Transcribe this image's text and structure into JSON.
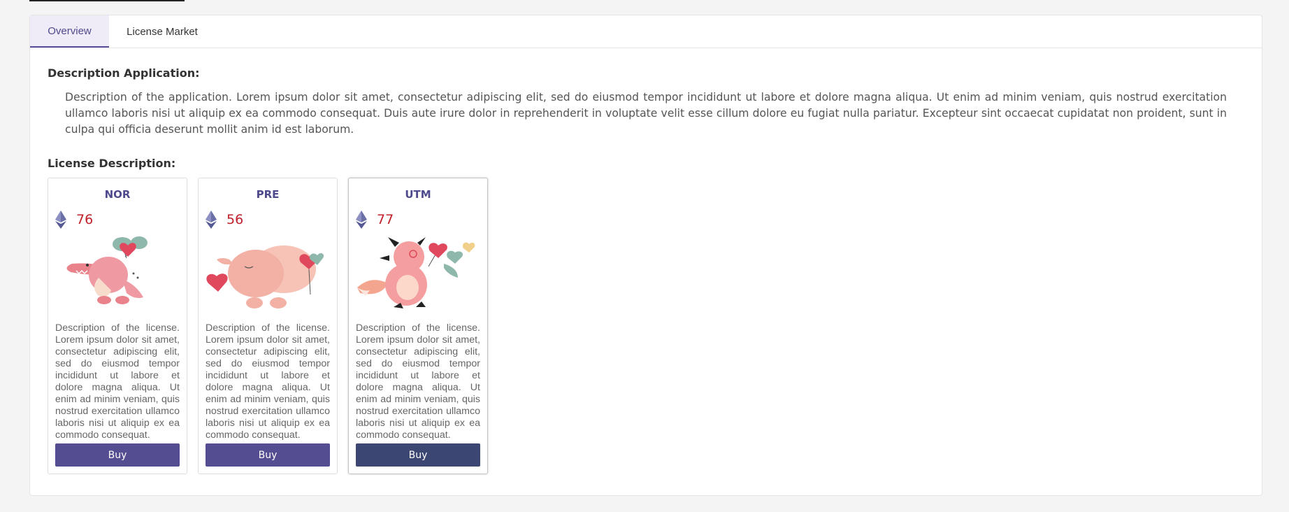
{
  "tabs": [
    {
      "label": "Overview",
      "active": true
    },
    {
      "label": "License Market",
      "active": false
    }
  ],
  "application": {
    "heading": "Description Application:",
    "text": "Description of the application. Lorem ipsum dolor sit amet, consectetur adipiscing elit, sed do eiusmod tempor incididunt ut labore et dolore magna aliqua. Ut enim ad minim veniam, quis nostrud exercitation ullamco laboris nisi ut aliquip ex ea commodo consequat. Duis aute irure dolor in reprehenderit in voluptate velit esse cillum dolore eu fugiat nulla pariatur. Excepteur sint occaecat cupidatat non proident, sunt in culpa qui officia deserunt mollit anim id est laborum."
  },
  "licenses": {
    "heading": "License Description:",
    "cards": [
      {
        "name": "NOR",
        "price": "76",
        "icon": "ethereum-icon",
        "illustration": "crocodile-with-balloons",
        "description": "Description of the license. Lorem ipsum dolor sit amet, consectetur adipiscing elit, sed do eiusmod tempor incididunt ut labore et dolore magna aliqua. Ut enim ad minim veniam, quis nostrud exercitation ullamco laboris nisi ut aliquip ex ea commodo consequat.",
        "buy_label": "Buy"
      },
      {
        "name": "PRE",
        "price": "56",
        "icon": "ethereum-icon",
        "illustration": "elephant-with-hearts",
        "description": "Description of the license. Lorem ipsum dolor sit amet, consectetur adipiscing elit, sed do eiusmod tempor incididunt ut labore et dolore magna aliqua. Ut enim ad minim veniam, quis nostrud exercitation ullamco laboris nisi ut aliquip ex ea commodo consequat.",
        "buy_label": "Buy"
      },
      {
        "name": "UTM",
        "price": "77",
        "icon": "ethereum-icon",
        "illustration": "fox-with-balloons",
        "description": "Description of the license. Lorem ipsum dolor sit amet, consectetur adipiscing elit, sed do eiusmod tempor incididunt ut labore et dolore magna aliqua. Ut enim ad minim veniam, quis nostrud exercitation ullamco laboris nisi ut aliquip ex ea commodo consequat.",
        "buy_label": "Buy"
      }
    ]
  },
  "colors": {
    "accent": "#4e4a8c",
    "button": "#554d91",
    "button_selected": "#3c4672",
    "price": "#c0202a",
    "tab_active_bg": "#efebf7"
  }
}
